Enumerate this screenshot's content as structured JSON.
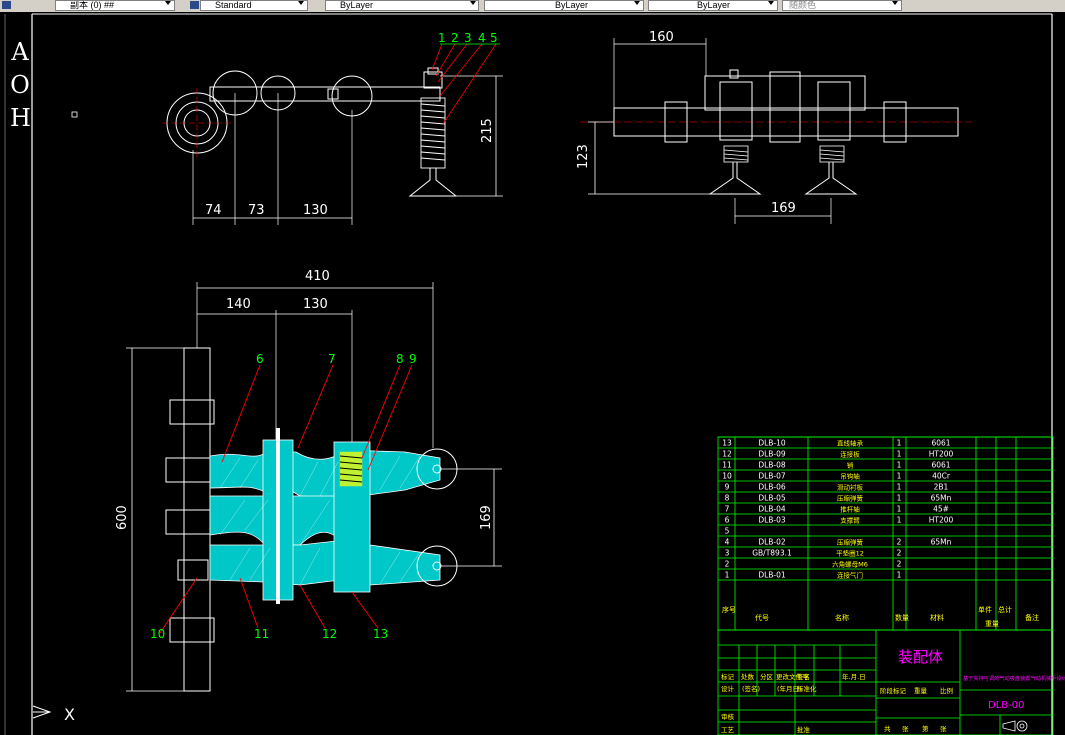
{
  "toolbar": {
    "layer_value": "副本 (0) ##",
    "style_value": "Standard",
    "color_value": "ByLayer",
    "linetype_value": "ByLayer",
    "lineweight_value": "ByLayer",
    "plotstyle_value": "随颜色"
  },
  "side_letters": [
    "A",
    "O",
    "H"
  ],
  "ucs": {
    "x_label": "X"
  },
  "top_view": {
    "balloons": [
      "1",
      "2",
      "3",
      "4",
      "5"
    ],
    "dims": {
      "d74": "74",
      "d73": "73",
      "d130": "130",
      "d215": "215"
    }
  },
  "side_view": {
    "dims": {
      "d160": "160",
      "d123": "123",
      "d169": "169"
    }
  },
  "main_view": {
    "balloons_top": [
      "6",
      "7",
      "8",
      "9"
    ],
    "balloons_bottom": [
      "10",
      "11",
      "12",
      "13"
    ],
    "dims": {
      "d410": "410",
      "d140": "140",
      "d130": "130",
      "d600": "600",
      "d169": "169"
    }
  },
  "bom": {
    "rows": [
      {
        "no": "13",
        "code": "DLB-10",
        "name": "直线轴承",
        "qty": "1",
        "mat": "6061"
      },
      {
        "no": "12",
        "code": "DLB-09",
        "name": "连接板",
        "qty": "1",
        "mat": "HT200"
      },
      {
        "no": "11",
        "code": "DLB-08",
        "name": "销",
        "qty": "1",
        "mat": "6061"
      },
      {
        "no": "10",
        "code": "DLB-07",
        "name": "吊钩轴",
        "qty": "1",
        "mat": "40Cr"
      },
      {
        "no": "9",
        "code": "DLB-06",
        "name": "滑动衬板",
        "qty": "1",
        "mat": "2B1"
      },
      {
        "no": "8",
        "code": "DLB-05",
        "name": "压缩弹簧",
        "qty": "1",
        "mat": "65Mn"
      },
      {
        "no": "7",
        "code": "DLB-04",
        "name": "推杆轴",
        "qty": "1",
        "mat": "45#"
      },
      {
        "no": "6",
        "code": "DLB-03",
        "name": "支撑臂",
        "qty": "1",
        "mat": "HT200"
      },
      {
        "no": "5",
        "code": "",
        "name": "",
        "qty": "",
        "mat": ""
      },
      {
        "no": "4",
        "code": "DLB-02",
        "name": "压缩弹簧",
        "qty": "2",
        "mat": "65Mn"
      },
      {
        "no": "3",
        "code": "GB/T893.1",
        "name": "平垫圈12",
        "qty": "2",
        "mat": ""
      },
      {
        "no": "2",
        "code": "",
        "name": "六角螺母M6",
        "qty": "2",
        "mat": ""
      },
      {
        "no": "1",
        "code": "DLB-01",
        "name": "连接气门",
        "qty": "1",
        "mat": ""
      }
    ],
    "header": {
      "no": "序号",
      "code": "代号",
      "name": "名称",
      "qty": "数量",
      "mat": "材料",
      "single": "单件",
      "total": "总计",
      "wt": "重量",
      "note": "备注"
    }
  },
  "titleblock": {
    "assembly": "装配体",
    "project": "基于夹持可调的气动吸盘装置气动机械手设计",
    "drawing_no": "DLB-00",
    "labels": {
      "design": "设计",
      "std": "标准化",
      "process": "工艺",
      "check": "审核",
      "approve": "批准",
      "mark": "标记",
      "count": "处数",
      "zone": "分区",
      "change": "更改文件号",
      "sign": "签名",
      "date": "年.月.日",
      "stage": "阶段标记",
      "weight": "重量",
      "scale": "比例",
      "sign2": "(签名)",
      "date2": "(年月日)",
      "total": "共",
      "sheet": "张",
      "no": "第"
    }
  },
  "colors": {
    "line": "#ffffff",
    "dim": "#ffffff",
    "leader": "#ff0000",
    "balloon": "#00ff00",
    "hatch": "#00e5e5",
    "table": "#00ff00",
    "table_text": "#ffffff",
    "title_text": "#ff00ff",
    "spring": "#ffff00"
  }
}
